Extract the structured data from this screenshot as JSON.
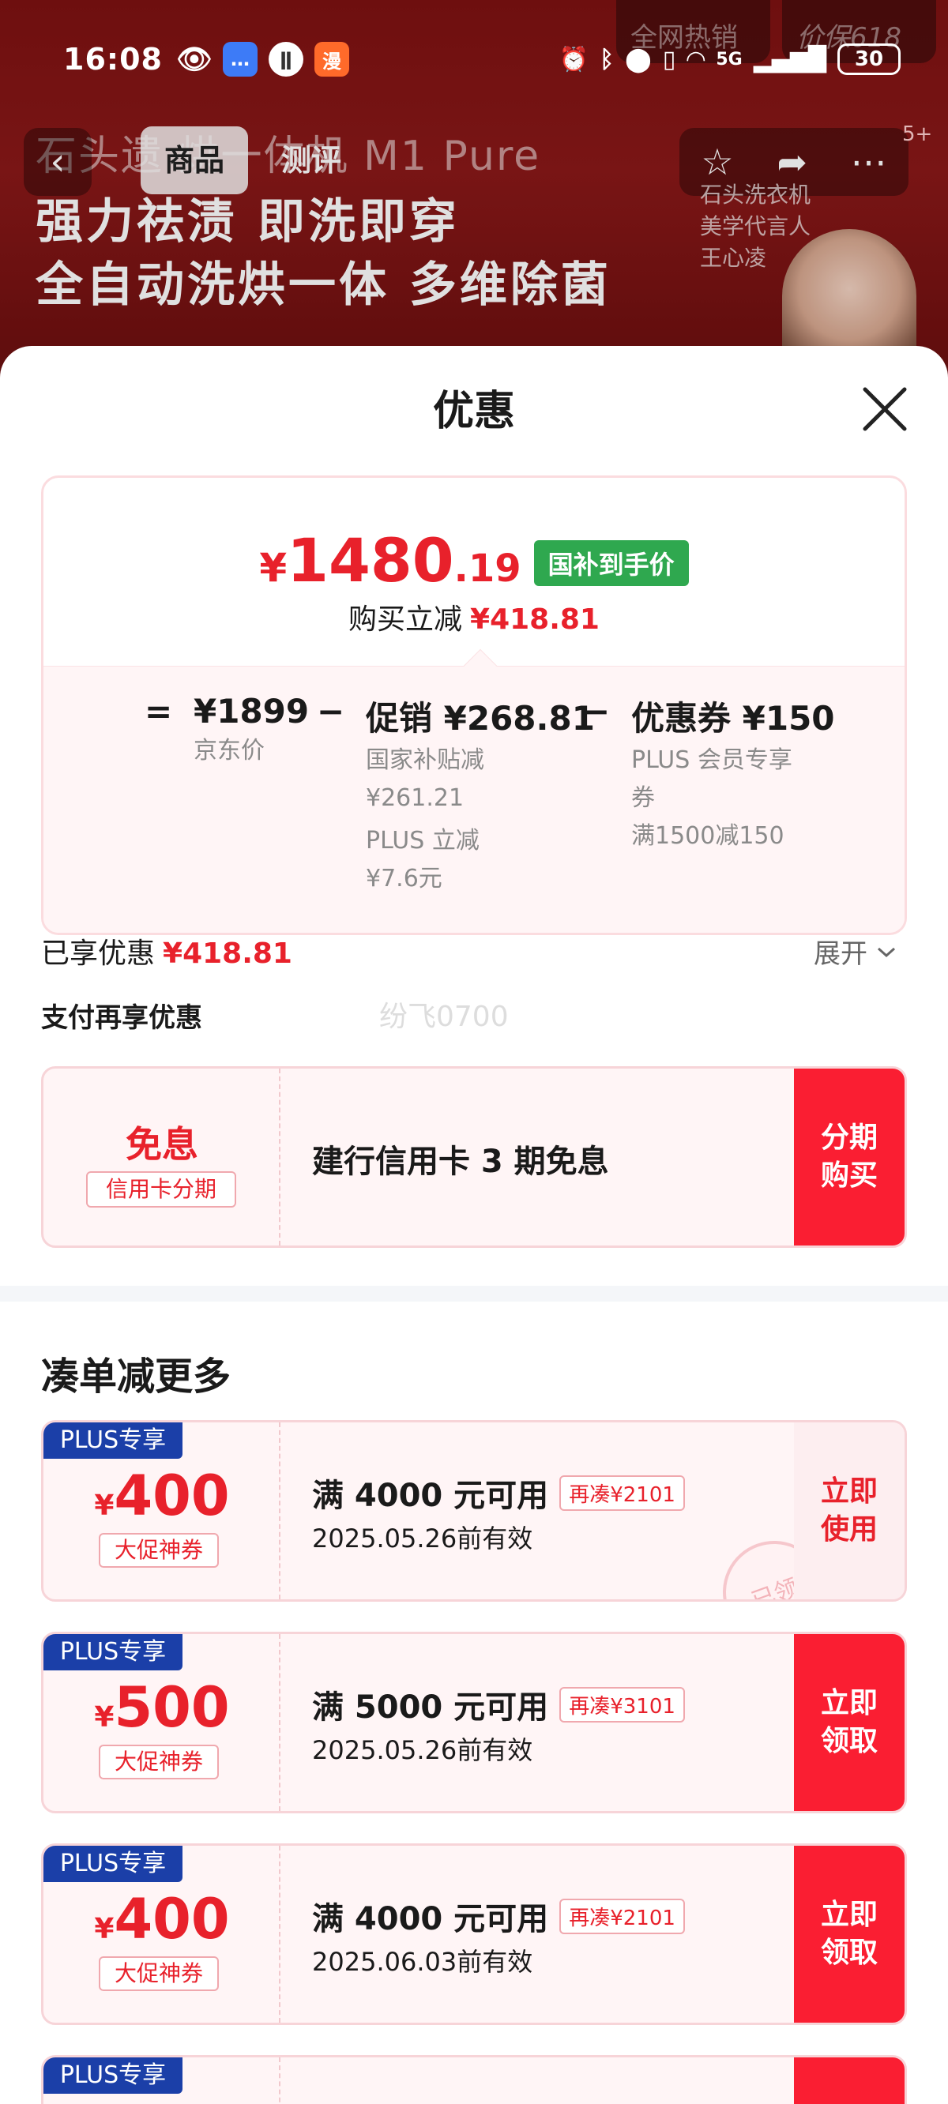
{
  "status_bar": {
    "time": "16:08",
    "battery": "30",
    "network": "5G"
  },
  "background_page": {
    "hot_tab": "全网热销",
    "price_tab": "价保618",
    "title": "石头遗 烘一体机 M1 Pure",
    "tabs": [
      "商品",
      "测评"
    ],
    "slogan_line1": "强力祛渍 即洗即穿",
    "slogan_line2": "全自动洗烘一体 多维除菌",
    "spokesperson_line1": "石头洗衣机",
    "spokesperson_line2": "美学代言人",
    "spokesperson_name": "王心凌",
    "badge": "5+"
  },
  "sheet": {
    "title": "优惠",
    "final_price": {
      "symbol": "¥",
      "integer": "1480",
      "decimal": ".19",
      "badge": "国补到手价"
    },
    "instant_discount_label": "购买立减",
    "instant_discount_value": "¥418.81",
    "calc": {
      "equals": "=",
      "minus": "−",
      "jd_price": "¥1899",
      "jd_price_label": "京东价",
      "promo_value": "促销 ¥268.81",
      "promo_note1": "国家补贴减",
      "promo_note1_value": "¥261.21",
      "promo_note2": "PLUS 立减",
      "promo_note2_value": "¥7.6元",
      "coupon_value": "优惠券 ¥150",
      "coupon_note1": "PLUS 会员专享",
      "coupon_note1b": "券",
      "coupon_note2": "满1500减150"
    },
    "enjoyed_label": "已享优惠",
    "enjoyed_value": "¥418.81",
    "expand_label": "展开",
    "pay_title": "支付再享优惠",
    "watermark": "纷飞0700",
    "installment": {
      "tag": "免息",
      "tag_sub": "信用卡分期",
      "desc": "建行信用卡 3 期免息",
      "action_line1": "分期",
      "action_line2": "购买"
    },
    "bundle_title": "凑单减更多",
    "coupons": [
      {
        "plus": "PLUS专享",
        "symbol": "¥",
        "amount": "400",
        "sub": "大促神券",
        "condition": "满 4000 元可用",
        "more": "再凑¥2101",
        "valid": "2025.05.26前有效",
        "action_line1": "立即",
        "action_line2": "使用",
        "stamp": "已领"
      },
      {
        "plus": "PLUS专享",
        "symbol": "¥",
        "amount": "500",
        "sub": "大促神券",
        "condition": "满 5000 元可用",
        "more": "再凑¥3101",
        "valid": "2025.05.26前有效",
        "action_line1": "立即",
        "action_line2": "领取"
      },
      {
        "plus": "PLUS专享",
        "symbol": "¥",
        "amount": "400",
        "sub": "大促神券",
        "condition": "满 4000 元可用",
        "more": "再凑¥2101",
        "valid": "2025.06.03前有效",
        "action_line1": "立即",
        "action_line2": "领取"
      },
      {
        "plus": "PLUS专享"
      }
    ]
  },
  "colors": {
    "brand_red": "#e8212b",
    "button_red": "#fa1e32",
    "badge_green": "#2fa84f",
    "plus_blue": "#1b3fa8"
  }
}
